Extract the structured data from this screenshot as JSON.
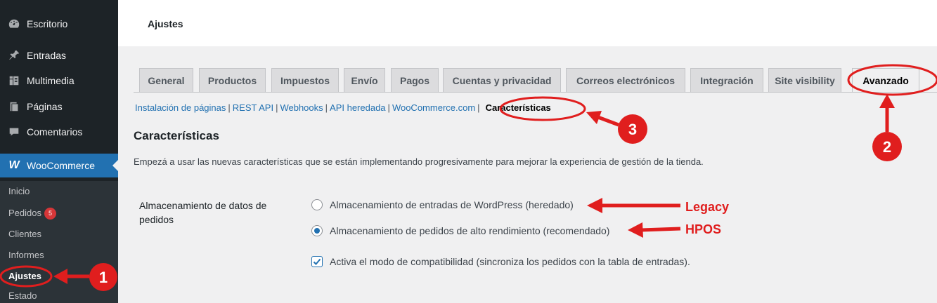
{
  "sidebar": {
    "items": [
      {
        "label": "Escritorio",
        "icon": "dashboard-icon"
      },
      {
        "label": "Entradas",
        "icon": "pin-icon"
      },
      {
        "label": "Multimedia",
        "icon": "media-icon"
      },
      {
        "label": "Páginas",
        "icon": "page-icon"
      },
      {
        "label": "Comentarios",
        "icon": "comment-icon"
      },
      {
        "label": "WooCommerce",
        "icon": "woocommerce-icon"
      }
    ],
    "submenu": [
      {
        "label": "Inicio"
      },
      {
        "label": "Pedidos",
        "badge": "5"
      },
      {
        "label": "Clientes"
      },
      {
        "label": "Informes"
      },
      {
        "label": "Ajustes"
      },
      {
        "label": "Estado"
      }
    ]
  },
  "header": {
    "title": "Ajustes"
  },
  "tabs": [
    {
      "label": "General"
    },
    {
      "label": "Productos"
    },
    {
      "label": "Impuestos"
    },
    {
      "label": "Envío"
    },
    {
      "label": "Pagos"
    },
    {
      "label": "Cuentas y privacidad"
    },
    {
      "label": "Correos electrónicos"
    },
    {
      "label": "Integración"
    },
    {
      "label": "Site visibility"
    },
    {
      "label": "Avanzado"
    }
  ],
  "subsub": [
    {
      "label": "Instalación de páginas"
    },
    {
      "label": "REST API"
    },
    {
      "label": "Webhooks"
    },
    {
      "label": "API heredada"
    },
    {
      "label": "WooCommerce.com"
    },
    {
      "label": "Características"
    }
  ],
  "main": {
    "title": "Características",
    "description": "Empezá a usar las nuevas características que se están implementando progresivamente para mejorar la experiencia de gestión de la tienda.",
    "field_label": "Almacenamiento de datos de pedidos",
    "options": [
      {
        "label": "Almacenamiento de entradas de WordPress (heredado)",
        "checked": false
      },
      {
        "label": "Almacenamiento de pedidos de alto rendimiento (recomendado)",
        "checked": true
      }
    ],
    "compat_label": "Activa el modo de compatibilidad (sincroniza los pedidos con la tabla de entradas).",
    "compat_checked": true
  },
  "annotations": {
    "step1": "1",
    "step2": "2",
    "step3": "3",
    "legacy": "Legacy",
    "hpos": "HPOS"
  },
  "colors": {
    "sidebar_bg": "#1d2327",
    "accent": "#2271b1",
    "annotation_red": "#e01e1e",
    "badge_red": "#d63638"
  }
}
